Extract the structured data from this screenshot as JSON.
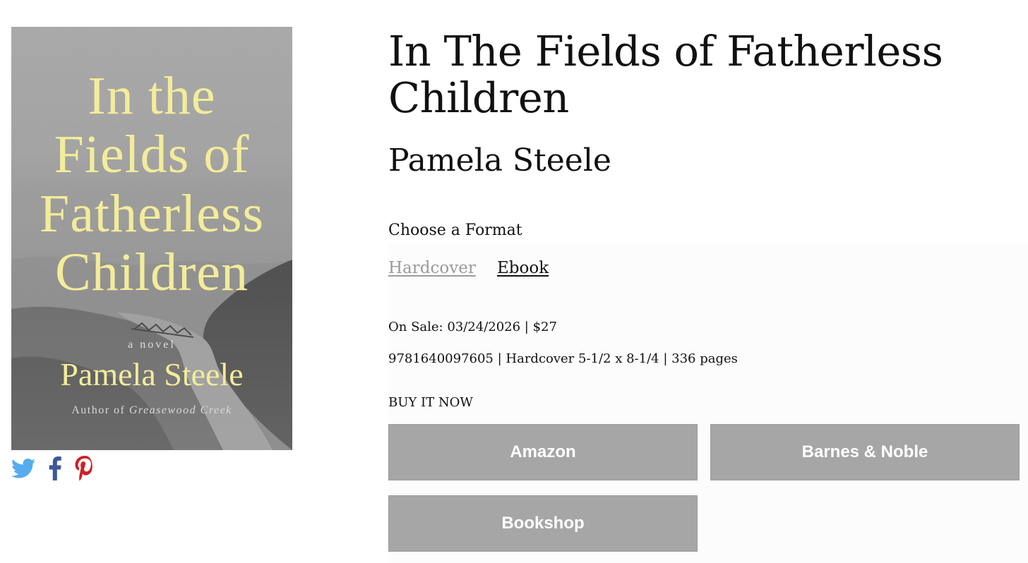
{
  "cover": {
    "title_lines": [
      "In the",
      "Fields of",
      "Fatherless",
      "Children"
    ],
    "novel_label": "a novel",
    "author": "Pamela Steele",
    "author_of_prefix": "Author of",
    "previous_title": "Greasewood Creek",
    "title_color": "#f3ec9a"
  },
  "social": {
    "icons": [
      "twitter-icon",
      "facebook-icon",
      "pinterest-icon"
    ],
    "colors": {
      "twitter": "#55acee",
      "facebook": "#3b5998",
      "pinterest": "#cb2027"
    }
  },
  "book": {
    "title": "In The Fields of Fatherless Children",
    "author": "Pamela Steele"
  },
  "format": {
    "label": "Choose a Format",
    "options": [
      {
        "label": "Hardcover",
        "selected": true
      },
      {
        "label": "Ebook",
        "selected": false
      }
    ]
  },
  "details": {
    "sale_line": "On Sale: 03/24/2026 | $27",
    "info_line": "9781640097605 | Hardcover 5-1/2 x 8-1/4 | 336 pages"
  },
  "buy": {
    "heading": "BUY IT NOW",
    "retailers": [
      "Amazon",
      "Barnes & Noble",
      "Bookshop"
    ],
    "button_color": "#a6a6a6"
  }
}
